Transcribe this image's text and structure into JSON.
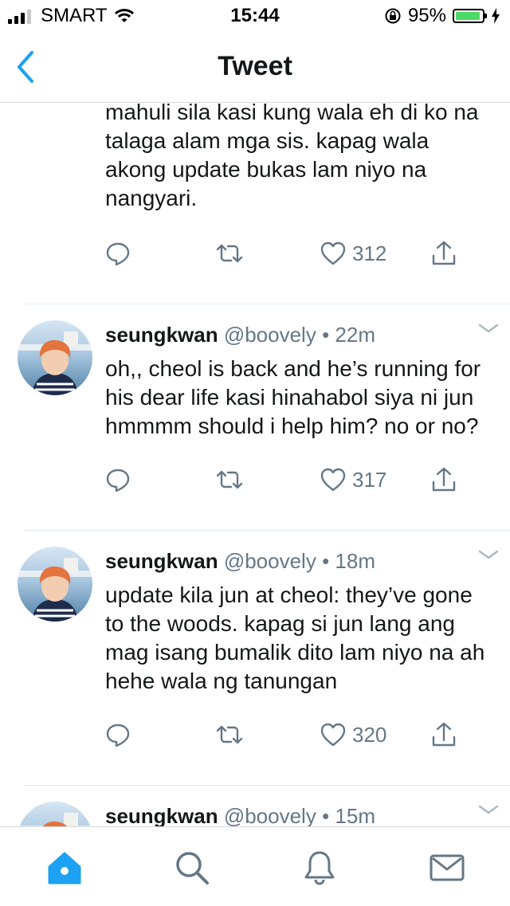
{
  "status_bar": {
    "carrier": "SMART",
    "time": "15:44",
    "battery_percent": "95%",
    "signal_bars": 3,
    "battery_level": 0.95
  },
  "nav": {
    "title": "Tweet"
  },
  "tweets": [
    {
      "partial_top": true,
      "text": "mahuli sila kasi kung wala eh di ko na talaga alam mga sis. kapag wala akong update bukas lam niyo na nangyari.",
      "likes": "312"
    },
    {
      "name": "seungkwan",
      "handle": "@boovely",
      "time": "22m",
      "separator": "•",
      "text": "oh,, cheol is back and he’s running for his dear life kasi hinahabol siya ni jun hmmmm should i help him? no or no?",
      "likes": "317"
    },
    {
      "name": "seungkwan",
      "handle": "@boovely",
      "time": "18m",
      "separator": "•",
      "text": "update kila jun at cheol: they’ve gone to the woods. kapag si jun lang ang mag isang bumalik dito lam niyo na ah hehe wala ng tanungan",
      "likes": "320"
    },
    {
      "name": "seungkwan",
      "handle": "@boovely",
      "time": "15m",
      "separator": "•"
    }
  ],
  "tab_bar": {
    "items": [
      "home-icon",
      "search-icon",
      "bell-icon",
      "mail-icon"
    ],
    "active": "home-icon"
  },
  "colors": {
    "accent": "#1da1f2",
    "secondary_text": "#657786",
    "primary_text": "#14171a",
    "battery": "#4cd964",
    "divider": "#e1e8ed"
  }
}
